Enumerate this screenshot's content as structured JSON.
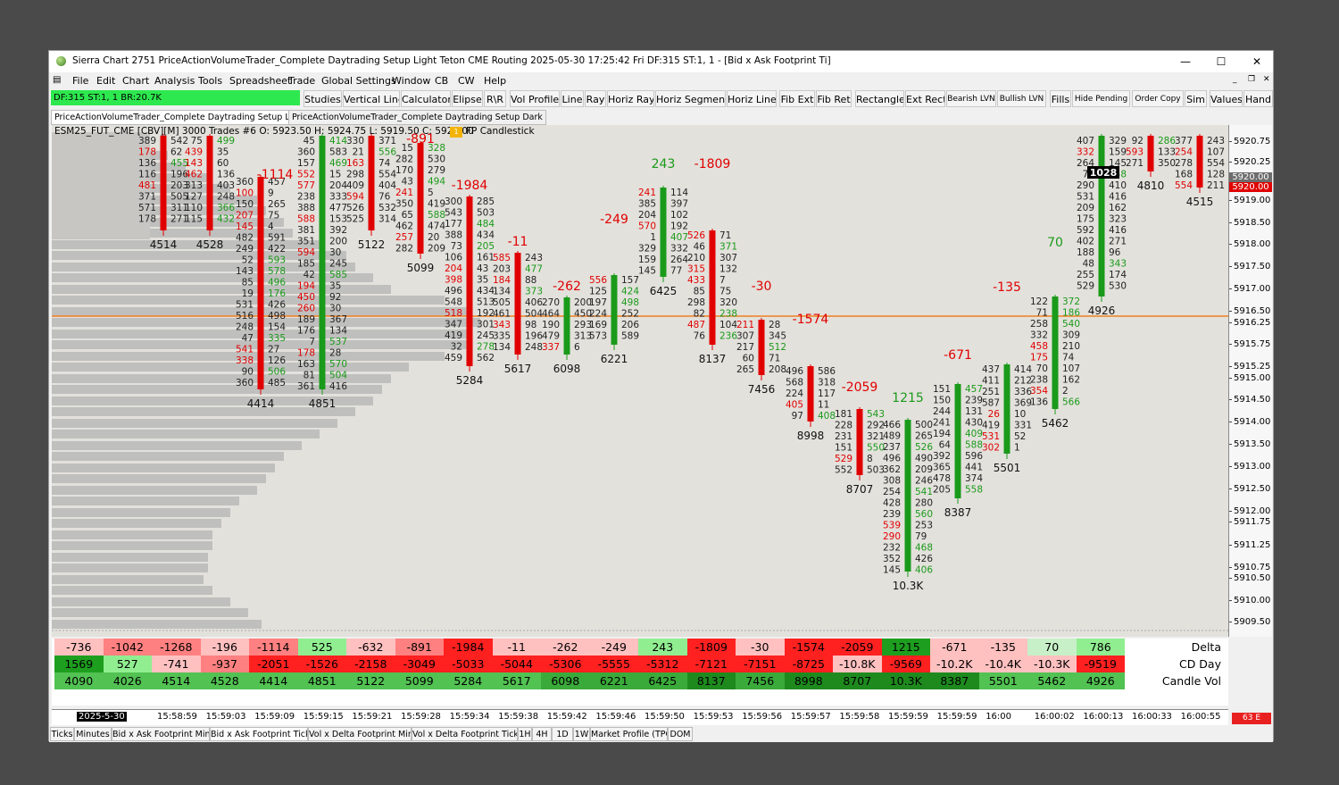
{
  "window": {
    "title": "Sierra Chart 2751 PriceActionVolumeTrader_Complete Daytrading Setup Light Teton CME Routing 2025-05-30  17:25:42 Fri DF:315  ST:1, 1 - [Bid x Ask Footprint Ti]",
    "minimize": "—",
    "maximize": "☐",
    "close": "✕"
  },
  "menu": [
    "File",
    "Edit",
    "Chart",
    "Analysis",
    "Tools",
    "Spreadsheet",
    "Trade",
    "Global Settings",
    "Window",
    "CB",
    "CW",
    "Help"
  ],
  "status_box": "DF:315  ST:1, 1  BR:20.7K",
  "toolbar": [
    "Studies",
    "Vertical Line",
    "Calculator",
    "Elipse",
    "R\\R",
    "Vol Profile",
    "Line",
    "Ray",
    "Horiz Ray",
    "Horiz Segment",
    "Horiz Line",
    "Fib Ext",
    "Fib Ret",
    "Rectangle",
    "Ext Rect",
    "Bearish LVN",
    "Bullish LVN",
    "Fills",
    "Hide Pending",
    "Order Copy",
    "Sim",
    "Values",
    "Hand"
  ],
  "chart_tabs": [
    "PriceActionVolumeTrader_Complete Daytrading Setup Light",
    "PriceActionVolumeTrader_Complete Daytrading Setup Dark"
  ],
  "chart_info": "ESM25_FUT_CME [CBV][M]  3000 Trades #6 O: 5923.50 H: 5924.75 L: 5919.50 C: 5920.00",
  "fp_badge": "1",
  "fp_label": "FP Candlestick",
  "price_axis": {
    "ticks": [
      "5920.75",
      "5920.25",
      "5919.50",
      "5919.00",
      "5918.50",
      "5918.00",
      "5917.50",
      "5917.00",
      "5916.50",
      "5916.25",
      "5915.75",
      "5915.25",
      "5915.00",
      "5914.50",
      "5914.00",
      "5913.50",
      "5913.00",
      "5912.50",
      "5912.00",
      "5911.75",
      "5911.25",
      "5910.75",
      "5910.50",
      "5910.00",
      "5909.50"
    ],
    "last_price_badge": "5920.00",
    "last_price_badge_2": "5920.00",
    "last_price_color": "#e00000",
    "badge_gray_color": "#6d6d6d"
  },
  "orange_line_price": "5916.50",
  "candle_volumes": [
    "4514",
    "4528",
    "4414",
    "4851",
    "5122",
    "5099",
    "5284",
    "5617",
    "6098",
    "6221",
    "6425",
    "8137",
    "7456",
    "8998",
    "8707",
    "10.3K",
    "8387",
    "5501",
    "5462",
    "4926",
    "4810",
    "4515"
  ],
  "cum_labels": [
    "-1114",
    "-891",
    "-1984",
    "-11",
    "-262",
    "-249",
    "243",
    "-1809",
    "-30",
    "-1574",
    "-2059",
    "1215",
    "-671",
    "-135",
    "70"
  ],
  "crosshair_value": "1028",
  "bottom_panel": {
    "labels": [
      "Delta",
      "CD Day",
      "Candle Vol"
    ],
    "delta": [
      "-736",
      "-1042",
      "-1268",
      "-196",
      "-1114",
      "525",
      "-632",
      "-891",
      "-1984",
      "-11",
      "-262",
      "-249",
      "243",
      "-1809",
      "-30",
      "-1574",
      "-2059",
      "1215",
      "-671",
      "-135",
      "70",
      "786"
    ],
    "cd_day": [
      "1569",
      "527",
      "-741",
      "-937",
      "-2051",
      "-1526",
      "-2158",
      "-3049",
      "-5033",
      "-5044",
      "-5306",
      "-5555",
      "-5312",
      "-7121",
      "-7151",
      "-8725",
      "-10.8K",
      "-9569",
      "-10.2K",
      "-10.4K",
      "-10.3K",
      "-9519"
    ],
    "candle_vol": [
      "4090",
      "4026",
      "4514",
      "4528",
      "4414",
      "4851",
      "5122",
      "5099",
      "5284",
      "5617",
      "6098",
      "6221",
      "6425",
      "8137",
      "7456",
      "8998",
      "8707",
      "10.3K",
      "8387",
      "5501",
      "5462",
      "4926"
    ]
  },
  "time_axis": {
    "date": "2025-5-30",
    "times": [
      "15:58:59",
      "15:59:03",
      "15:59:09",
      "15:59:15",
      "15:59:21",
      "15:59:28",
      "15:59:34",
      "15:59:38",
      "15:59:42",
      "15:59:46",
      "15:59:50",
      "15:59:53",
      "15:59:56",
      "15:59:57",
      "15:59:58",
      "15:59:59",
      "15:59:59",
      "16:00",
      "16:00:02",
      "16:00:13",
      "16:00:33",
      "16:00:55"
    ],
    "end_badge": "63 E"
  },
  "bottom_tabs": [
    "Ticks",
    "Minutes",
    "Bid x Ask Footprint Min",
    "Bid x Ask Footprint Tick",
    "Vol x Delta Footprint Min",
    "Vol x Delta Footprint Tick",
    "1H",
    "4H",
    "1D",
    "1W",
    "Market Profile (TPO)",
    "DOM"
  ],
  "colors": {
    "up": "#1a9a1a",
    "down": "#e00000",
    "chart_bg": "#e3e1dc",
    "profile": "#b9b9b9",
    "orange": "#f08020"
  }
}
